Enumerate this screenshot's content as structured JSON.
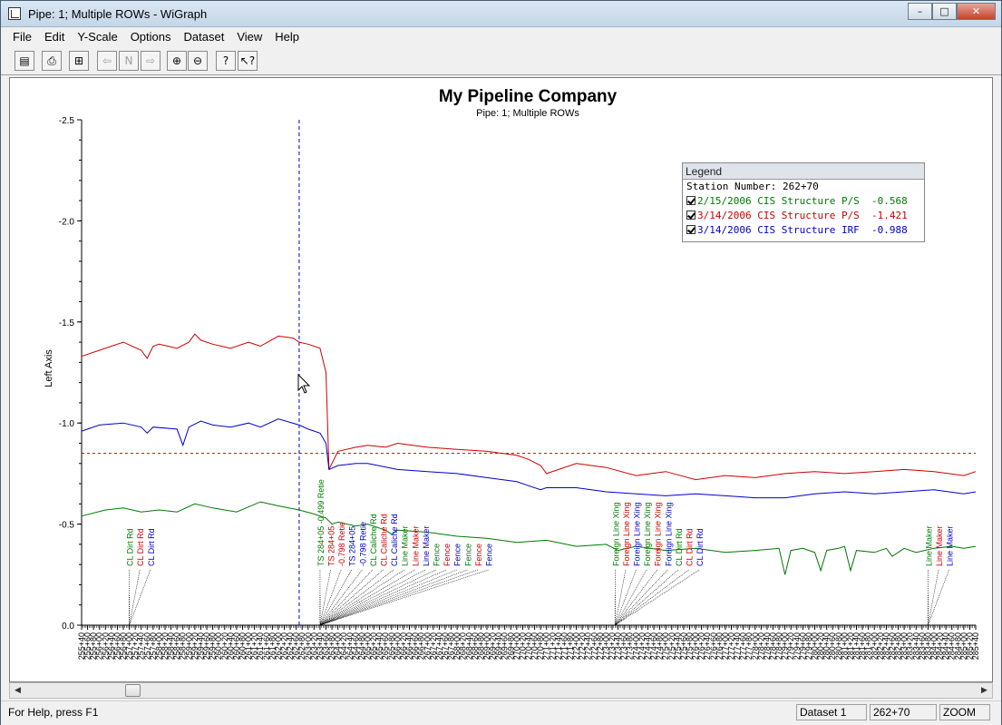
{
  "window": {
    "title": "Pipe: 1; Multiple ROWs - WiGraph",
    "min": "–",
    "max": "□",
    "close": "✕"
  },
  "menu": [
    "File",
    "Edit",
    "Y-Scale",
    "Options",
    "Dataset",
    "View",
    "Help"
  ],
  "toolbar": {
    "icons": [
      "clipboard-icon",
      "print-icon",
      "export-icon",
      "prev-icon",
      "nth-icon",
      "next-icon",
      "zoom-in-icon",
      "zoom-out-icon",
      "help-icon",
      "context-help-icon"
    ]
  },
  "status": {
    "help": "For Help, press F1",
    "dataset": "Dataset 1",
    "station": "262+70",
    "mode": "ZOOM"
  },
  "colors": {
    "green": "#007a00",
    "red": "#cc0000",
    "blue": "#0000cc"
  },
  "legend": {
    "title": "Legend",
    "station_label": "Station Number: 262+70",
    "entries": [
      {
        "text": "2/15/2006 CIS Structure P/S  -0.568",
        "color": "#007a00"
      },
      {
        "text": "3/14/2006 CIS Structure P/S  -1.421",
        "color": "#cc0000"
      },
      {
        "text": "3/14/2006 CIS Structure IRF  -0.988",
        "color": "#0000cc"
      }
    ]
  },
  "chart_data": {
    "type": "line",
    "title": "My Pipeline Company",
    "subtitle": "Pipe: 1; Multiple ROWs",
    "ylabel": "Left Axis",
    "xlabel": "",
    "ylim": [
      0.0,
      -2.5
    ],
    "y_ticks": [
      "-2.5",
      "-2.0",
      "-1.5",
      "-1.0",
      "-0.5",
      "0.0"
    ],
    "x_tick_labels": [
      "255+40",
      "255+60",
      "255+80",
      "256+00",
      "256+20",
      "256+40",
      "256+60",
      "256+80",
      "257+00",
      "257+20",
      "257+40",
      "257+60",
      "257+80",
      "258+00",
      "258+20",
      "258+40",
      "258+60",
      "258+80",
      "259+00",
      "259+20",
      "259+40",
      "259+60",
      "259+80",
      "260+00",
      "260+20",
      "260+40",
      "260+60",
      "260+80",
      "261+00",
      "261+20",
      "261+40",
      "261+60",
      "261+80",
      "262+00",
      "262+20",
      "262+40",
      "262+60",
      "262+80",
      "263+00",
      "263+20",
      "263+40",
      "263+60",
      "263+80",
      "264+00",
      "264+20",
      "264+40",
      "264+60",
      "264+80",
      "265+00",
      "265+20",
      "265+40",
      "265+60",
      "265+80",
      "266+00",
      "266+20",
      "266+40",
      "266+60",
      "266+80",
      "267+00",
      "267+20",
      "267+40",
      "267+60",
      "267+80",
      "268+00",
      "268+20",
      "268+40",
      "268+60",
      "268+80",
      "269+00",
      "269+20",
      "269+40",
      "269+60",
      "269+80",
      "270+00",
      "270+20",
      "270+40",
      "270+60",
      "270+80",
      "271+00",
      "271+20",
      "271+40",
      "271+60",
      "271+80",
      "272+00",
      "272+20",
      "272+40",
      "272+60",
      "272+80",
      "273+00",
      "273+20",
      "273+40",
      "273+60",
      "273+80",
      "274+00",
      "274+20",
      "274+40",
      "274+60",
      "274+80",
      "275+00",
      "275+20",
      "275+40",
      "275+60",
      "275+80",
      "276+00",
      "276+20",
      "276+40",
      "276+60",
      "276+80",
      "277+00",
      "277+20",
      "277+40",
      "277+60",
      "277+80",
      "278+00",
      "278+20",
      "278+40",
      "278+60",
      "278+80",
      "279+00",
      "279+20",
      "279+40",
      "279+60",
      "279+80",
      "280+00",
      "280+20",
      "280+40",
      "280+60",
      "280+80",
      "281+00",
      "281+20",
      "281+40",
      "281+60",
      "281+80",
      "282+00",
      "282+20",
      "282+40",
      "282+60",
      "282+80",
      "283+00",
      "283+20",
      "283+40",
      "283+60",
      "283+80",
      "284+00",
      "284+20",
      "284+40",
      "284+60",
      "284+80",
      "285+00",
      "285+20",
      "285+40"
    ],
    "x_range_stations": [
      25540,
      28540
    ],
    "cursor_station": 26270,
    "reference_line_y": -0.85,
    "series": [
      {
        "name": "2/15/2006 CIS Structure P/S",
        "color": "#007a00",
        "x": [
          25540,
          25620,
          25680,
          25740,
          25800,
          25860,
          25920,
          25980,
          26060,
          26140,
          26200,
          26270,
          26320,
          26360,
          26380,
          26400,
          26460,
          26500,
          26560,
          26580,
          26600,
          26700,
          26800,
          26900,
          27000,
          27100,
          27200,
          27300,
          27340,
          27400,
          27500,
          27600,
          27700,
          27800,
          27880,
          27900,
          27920,
          27960,
          28000,
          28020,
          28040,
          28080,
          28100,
          28120,
          28140,
          28200,
          28240,
          28260,
          28300,
          28340,
          28400,
          28460,
          28500,
          28540
        ],
        "y": [
          -0.54,
          -0.57,
          -0.58,
          -0.56,
          -0.57,
          -0.56,
          -0.6,
          -0.58,
          -0.56,
          -0.61,
          -0.59,
          -0.57,
          -0.55,
          -0.53,
          -0.5,
          -0.51,
          -0.49,
          -0.5,
          -0.47,
          -0.45,
          -0.47,
          -0.46,
          -0.44,
          -0.43,
          -0.41,
          -0.42,
          -0.39,
          -0.4,
          -0.37,
          -0.39,
          -0.37,
          -0.38,
          -0.36,
          -0.37,
          -0.38,
          -0.25,
          -0.37,
          -0.38,
          -0.36,
          -0.27,
          -0.37,
          -0.38,
          -0.39,
          -0.27,
          -0.37,
          -0.36,
          -0.38,
          -0.34,
          -0.38,
          -0.36,
          -0.38,
          -0.39,
          -0.38,
          -0.39
        ]
      },
      {
        "name": "3/14/2006 CIS Structure P/S",
        "color": "#cc0000",
        "x": [
          25540,
          25600,
          25680,
          25740,
          25760,
          25780,
          25800,
          25860,
          25900,
          25920,
          25940,
          25980,
          26040,
          26100,
          26140,
          26200,
          26250,
          26270,
          26300,
          26340,
          26360,
          26370,
          26400,
          26460,
          26500,
          26560,
          26600,
          26700,
          26800,
          26900,
          27000,
          27040,
          27080,
          27100,
          27200,
          27300,
          27400,
          27500,
          27600,
          27700,
          27800,
          27900,
          28000,
          28100,
          28200,
          28300,
          28400,
          28500,
          28540
        ],
        "y": [
          -1.33,
          -1.36,
          -1.4,
          -1.36,
          -1.32,
          -1.38,
          -1.39,
          -1.37,
          -1.4,
          -1.44,
          -1.41,
          -1.39,
          -1.37,
          -1.4,
          -1.38,
          -1.43,
          -1.42,
          -1.4,
          -1.39,
          -1.37,
          -1.25,
          -0.77,
          -0.86,
          -0.88,
          -0.89,
          -0.88,
          -0.9,
          -0.88,
          -0.87,
          -0.86,
          -0.84,
          -0.82,
          -0.79,
          -0.75,
          -0.8,
          -0.78,
          -0.74,
          -0.76,
          -0.72,
          -0.74,
          -0.73,
          -0.75,
          -0.76,
          -0.75,
          -0.76,
          -0.77,
          -0.76,
          -0.74,
          -0.76
        ]
      },
      {
        "name": "3/14/2006 CIS Structure IRF",
        "color": "#0000cc",
        "x": [
          25540,
          25600,
          25680,
          25740,
          25760,
          25780,
          25860,
          25880,
          25900,
          25940,
          25980,
          26040,
          26100,
          26140,
          26200,
          26270,
          26300,
          26340,
          26360,
          26370,
          26400,
          26460,
          26500,
          26600,
          26700,
          26800,
          26900,
          27000,
          27040,
          27080,
          27100,
          27200,
          27300,
          27400,
          27500,
          27600,
          27700,
          27800,
          27900,
          28000,
          28100,
          28200,
          28300,
          28400,
          28500,
          28540
        ],
        "y": [
          -0.96,
          -0.99,
          -1.0,
          -0.98,
          -0.95,
          -0.98,
          -0.97,
          -0.89,
          -0.98,
          -1.01,
          -0.99,
          -0.98,
          -1.0,
          -0.98,
          -1.02,
          -0.99,
          -0.97,
          -0.95,
          -0.9,
          -0.77,
          -0.79,
          -0.8,
          -0.8,
          -0.77,
          -0.76,
          -0.75,
          -0.73,
          -0.71,
          -0.69,
          -0.67,
          -0.68,
          -0.68,
          -0.66,
          -0.65,
          -0.64,
          -0.65,
          -0.64,
          -0.63,
          -0.63,
          -0.65,
          -0.66,
          -0.65,
          -0.66,
          -0.67,
          -0.65,
          -0.66
        ]
      }
    ],
    "annotations": {
      "groups": [
        {
          "anchor": 25700,
          "labels": [
            {
              "text": "CL Dirt Rd",
              "color": "#007a00"
            },
            {
              "text": "CL Dirt Rd",
              "color": "#cc0000"
            },
            {
              "text": "CL Dirt Rd",
              "color": "#0000cc"
            }
          ]
        },
        {
          "anchor": 26340,
          "labels": [
            {
              "text": "TS 284+05 -0.499 Retie",
              "color": "#007a00"
            },
            {
              "text": "TS 284+05",
              "color": "#cc0000"
            },
            {
              "text": "-0.798 Retie",
              "color": "#cc0000"
            },
            {
              "text": "TS 284+05",
              "color": "#0000cc"
            },
            {
              "text": "-0.798 Retie",
              "color": "#0000cc"
            },
            {
              "text": "CL Caliche Rd",
              "color": "#007a00"
            },
            {
              "text": "CL Caliche Rd",
              "color": "#cc0000"
            },
            {
              "text": "CL Caliche Rd",
              "color": "#0000cc"
            },
            {
              "text": "Line Maker",
              "color": "#007a00"
            },
            {
              "text": "Line Maker",
              "color": "#cc0000"
            },
            {
              "text": "Line Maker",
              "color": "#0000cc"
            },
            {
              "text": "Fence",
              "color": "#007a00"
            },
            {
              "text": "Fence",
              "color": "#cc0000"
            },
            {
              "text": "Fence",
              "color": "#0000cc"
            },
            {
              "text": "Fence",
              "color": "#007a00"
            },
            {
              "text": "Fence",
              "color": "#cc0000"
            },
            {
              "text": "Fence",
              "color": "#0000cc"
            }
          ]
        },
        {
          "anchor": 27330,
          "labels": [
            {
              "text": "Foreign Line Xing",
              "color": "#007a00"
            },
            {
              "text": "Foreign Line Xing",
              "color": "#cc0000"
            },
            {
              "text": "Foreign Line Xing",
              "color": "#0000cc"
            },
            {
              "text": "Foreign Line Xing",
              "color": "#007a00"
            },
            {
              "text": "Foreign Line Xing",
              "color": "#cc0000"
            },
            {
              "text": "Foreign Line Xing",
              "color": "#0000cc"
            },
            {
              "text": "CL Dirt Rd",
              "color": "#007a00"
            },
            {
              "text": "CL Dirt Rd",
              "color": "#cc0000"
            },
            {
              "text": "CL Dirt Rd",
              "color": "#0000cc"
            }
          ]
        },
        {
          "anchor": 28380,
          "labels": [
            {
              "text": "Line Maker",
              "color": "#007a00"
            },
            {
              "text": "Line Maker",
              "color": "#cc0000"
            },
            {
              "text": "Line Maker",
              "color": "#0000cc"
            }
          ]
        }
      ]
    }
  }
}
